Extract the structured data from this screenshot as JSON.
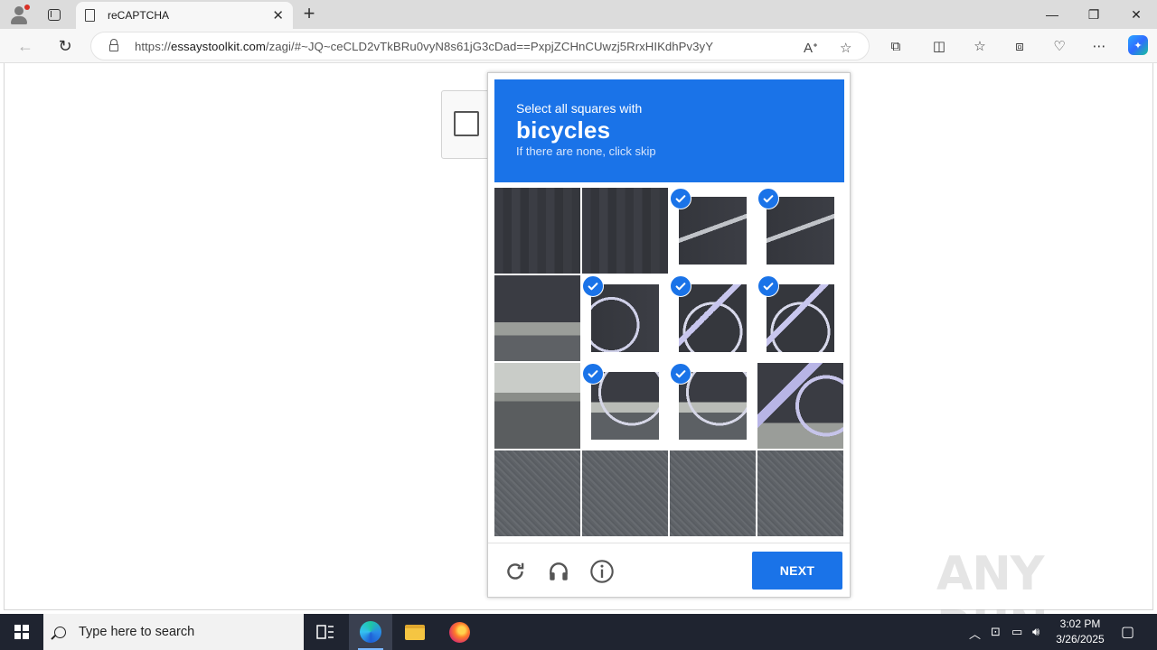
{
  "browser": {
    "tab_title": "reCAPTCHA",
    "url_prefix": "https://",
    "url_domain": "essaystoolkit.com",
    "url_rest": "/zagi/#~JQ~ceCLD2vTkBRu0vyN8s61jG3cDad==PxpjZCHnCUwzj5RrxHIKdhPv3yY"
  },
  "captcha": {
    "instruction_line1": "Select all squares with",
    "target_object": "bicycles",
    "instruction_line3": "If there are none, click skip",
    "tiles": [
      {
        "selected": false,
        "scene": "wall"
      },
      {
        "selected": false,
        "scene": "wall"
      },
      {
        "selected": true,
        "scene": "handle"
      },
      {
        "selected": true,
        "scene": "handle"
      },
      {
        "selected": false,
        "scene": "wallcurb"
      },
      {
        "selected": true,
        "scene": "wallbike"
      },
      {
        "selected": true,
        "scene": "bikeframe"
      },
      {
        "selected": true,
        "scene": "bikeframe"
      },
      {
        "selected": false,
        "scene": "curb"
      },
      {
        "selected": true,
        "scene": "wheelcurb"
      },
      {
        "selected": true,
        "scene": "wheelcurb"
      },
      {
        "selected": false,
        "scene": "bikeright"
      },
      {
        "selected": false,
        "scene": "asphalt"
      },
      {
        "selected": false,
        "scene": "asphalt"
      },
      {
        "selected": false,
        "scene": "asphalt"
      },
      {
        "selected": false,
        "scene": "asphalt"
      }
    ],
    "next_label": "NEXT"
  },
  "watermark": "ANY RUN",
  "taskbar": {
    "search_placeholder": "Type here to search",
    "time": "3:02 PM",
    "date": "3/26/2025"
  },
  "colors": {
    "accent": "#1a73e8",
    "taskbar": "#1f2430"
  }
}
